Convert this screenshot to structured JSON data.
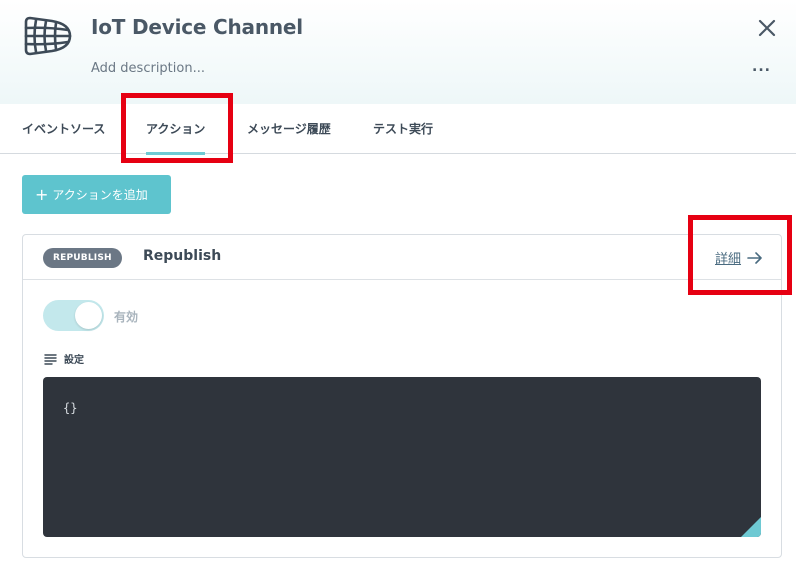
{
  "header": {
    "title": "IoT Device Channel",
    "description_placeholder": "Add description...",
    "logo_icon": "net-channel-icon",
    "close_icon": "close-icon",
    "more_label": "..."
  },
  "tabs": [
    {
      "label": "イベントソース",
      "active": false
    },
    {
      "label": "アクション",
      "active": true
    },
    {
      "label": "メッセージ履歴",
      "active": false
    },
    {
      "label": "テスト実行",
      "active": false
    }
  ],
  "add_action": {
    "plus": "+",
    "label": "アクションを追加"
  },
  "action_card": {
    "badge": "REPUBLISH",
    "name": "Republish",
    "detail_label": "詳細",
    "enabled_label": "有効",
    "enabled": true,
    "settings_label": "設定",
    "settings_value": "{}"
  },
  "colors": {
    "accent": "#5ec4ce",
    "toggle_track": "#c3e8ec",
    "badge_bg": "#6b7785",
    "editor_bg": "#2f343c",
    "highlight": "#e60012"
  }
}
